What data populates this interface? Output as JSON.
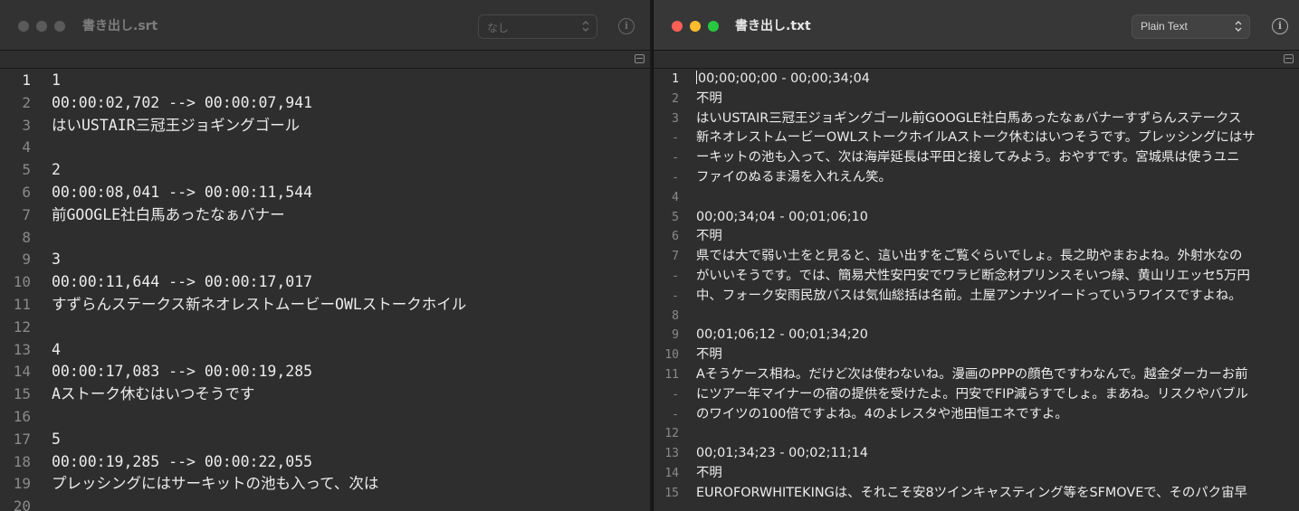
{
  "left_window": {
    "title": "書き出し.srt",
    "syntax_selector": "なし",
    "info_label": "i",
    "lines": [
      {
        "num": "1",
        "text": "1"
      },
      {
        "num": "2",
        "text": "00:00:02,702 --> 00:00:07,941"
      },
      {
        "num": "3",
        "text": "はいUSTAIR三冠王ジョギングゴール"
      },
      {
        "num": "4",
        "text": ""
      },
      {
        "num": "5",
        "text": "2"
      },
      {
        "num": "6",
        "text": "00:00:08,041 --> 00:00:11,544"
      },
      {
        "num": "7",
        "text": "前GOOGLE社白馬あったなぁバナー"
      },
      {
        "num": "8",
        "text": ""
      },
      {
        "num": "9",
        "text": "3"
      },
      {
        "num": "10",
        "text": "00:00:11,644 --> 00:00:17,017"
      },
      {
        "num": "11",
        "text": "すずらんステークス新ネオレストムービーOWLストークホイル"
      },
      {
        "num": "12",
        "text": ""
      },
      {
        "num": "13",
        "text": "4"
      },
      {
        "num": "14",
        "text": "00:00:17,083 --> 00:00:19,285"
      },
      {
        "num": "15",
        "text": "Aストーク休むはいつそうです"
      },
      {
        "num": "16",
        "text": ""
      },
      {
        "num": "17",
        "text": "5"
      },
      {
        "num": "18",
        "text": "00:00:19,285 --> 00:00:22,055"
      },
      {
        "num": "19",
        "text": "プレッシングにはサーキットの池も入って、次は"
      },
      {
        "num": "20",
        "text": ""
      }
    ]
  },
  "right_window": {
    "title": "書き出し.txt",
    "syntax_selector": "Plain Text",
    "info_label": "i",
    "lines": [
      {
        "num": "1",
        "text": "00;00;00;00 - 00;00;34;04"
      },
      {
        "num": "2",
        "text": "不明"
      },
      {
        "num": "3",
        "text": "はいUSTAIR三冠王ジョギングゴール前GOOGLE社白馬あったなぁバナーすずらんステークス"
      },
      {
        "num": "-",
        "text": "新ネオレストムービーOWLストークホイルAストーク休むはいつそうです。プレッシングにはサ"
      },
      {
        "num": "-",
        "text": "ーキットの池も入って、次は海岸延長は平田と接してみよう。おやすです。宮城県は使うユニ"
      },
      {
        "num": "-",
        "text": "ファイのぬるま湯を入れえん笑。"
      },
      {
        "num": "4",
        "text": ""
      },
      {
        "num": "5",
        "text": "00;00;34;04 - 00;01;06;10"
      },
      {
        "num": "6",
        "text": "不明"
      },
      {
        "num": "7",
        "text": "県では大で弱い土をと見ると、這い出すをご覧ぐらいでしょ。長之助やまおよね。外射水なの"
      },
      {
        "num": "-",
        "text": "がいいそうです。では、簡易犬性安円安でワラビ断念材プリンスそいつ緑、黄山リエッセ5万円"
      },
      {
        "num": "-",
        "text": "中、フォーク安雨民放バスは気仙総括は名前。土屋アンナツイードっていうワイスですよね。"
      },
      {
        "num": "8",
        "text": ""
      },
      {
        "num": "9",
        "text": "00;01;06;12 - 00;01;34;20"
      },
      {
        "num": "10",
        "text": "不明"
      },
      {
        "num": "11",
        "text": "Aそうケース相ね。だけど次は使わないね。漫画のPPPの顔色ですわなんで。越金ダーカーお前"
      },
      {
        "num": "-",
        "text": "にツアー年マイナーの宿の提供を受けたよ。円安でFIP減らすでしょ。まあね。リスクやバブル"
      },
      {
        "num": "-",
        "text": "のワイツの100倍ですよね。4のよレスタや池田恒エネですよ。"
      },
      {
        "num": "12",
        "text": ""
      },
      {
        "num": "13",
        "text": "00;01;34;23 - 00;02;11;14"
      },
      {
        "num": "14",
        "text": "不明"
      },
      {
        "num": "15",
        "text": "EUROFORWHITEKINGは、それこそ安8ツインキャスティング等をSFMOVEで、そのパク宙早"
      }
    ]
  }
}
